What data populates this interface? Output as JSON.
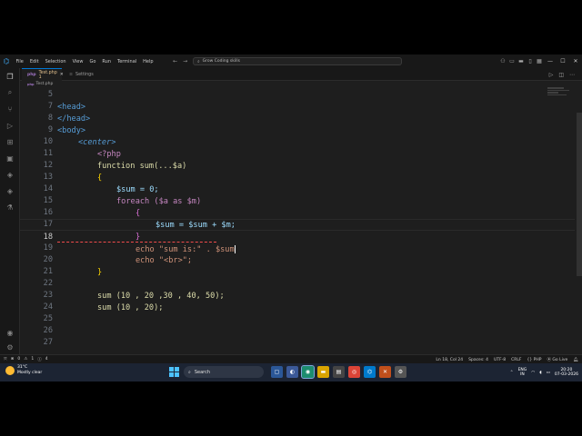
{
  "window": {
    "menu": [
      "File",
      "Edit",
      "Selection",
      "View",
      "Go",
      "Run",
      "Terminal",
      "Help"
    ],
    "search_text": "Grow Coding skills"
  },
  "tabs": [
    {
      "label": "Test.php 1",
      "active": true
    },
    {
      "label": "Settings",
      "active": false
    }
  ],
  "breadcrumb": {
    "file": "Test.php"
  },
  "editor": {
    "current_line": 18,
    "lines": [
      {
        "n": "5",
        "text": "<head>"
      },
      {
        "n": "7",
        "text": "</head>"
      },
      {
        "n": "8",
        "text": "<body>"
      },
      {
        "n": "9",
        "text": "<center>"
      },
      {
        "n": "10",
        "text": "<?php"
      },
      {
        "n": "11",
        "text": "function sum(...$a)"
      },
      {
        "n": "12",
        "text": "{"
      },
      {
        "n": "13",
        "text": "$sum = 0;"
      },
      {
        "n": "14",
        "text": "foreach ($a as $m)"
      },
      {
        "n": "15",
        "text": "{"
      },
      {
        "n": "16",
        "text": "$sum = $sum + $m;"
      },
      {
        "n": "17",
        "text": "}"
      },
      {
        "n": "18",
        "text": "echo \"sum is:\" . $sum"
      },
      {
        "n": "19",
        "text": "echo \"<br>\";"
      },
      {
        "n": "20",
        "text": "}"
      },
      {
        "n": "21",
        "text": ""
      },
      {
        "n": "22",
        "text": "sum (10 , 20 ,30 , 40, 50);"
      },
      {
        "n": "23",
        "text": "sum (10 , 20);"
      },
      {
        "n": "24",
        "text": ""
      },
      {
        "n": "25",
        "text": ""
      },
      {
        "n": "26",
        "text": ""
      },
      {
        "n": "27",
        "text": ""
      }
    ]
  },
  "statusbar": {
    "left": [
      "0",
      "1",
      "4"
    ],
    "position": "Ln 18, Col 24",
    "spaces": "Spaces: 4",
    "encoding": "UTF-8",
    "eol": "CRLF",
    "language": "PHP",
    "golive": "Go Live"
  },
  "taskbar": {
    "temperature": "31°C",
    "weather": "Mostly clear",
    "search": "Search",
    "lang": "ENG",
    "lang_region": "IN",
    "time": "20:20",
    "date": "07-03-2026"
  },
  "colors": {
    "editor_bg": "#1e1e1e",
    "accent": "#0078d4",
    "taskbar_bg": "#1c2433"
  }
}
